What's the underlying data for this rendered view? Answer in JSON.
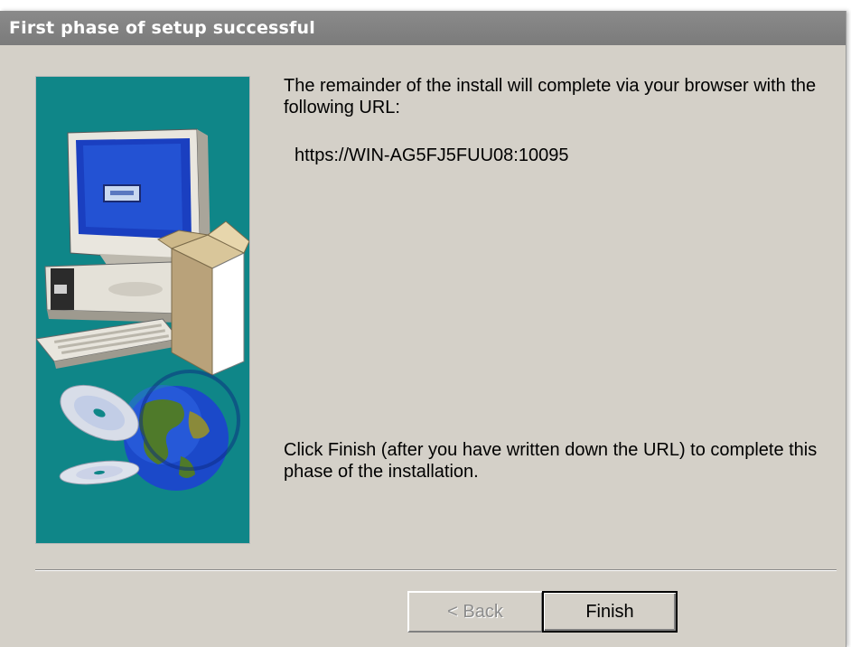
{
  "window": {
    "title": "First phase of setup successful"
  },
  "main": {
    "intro_text": "The remainder of the install will complete via your browser with the following URL:",
    "url": "https://WIN-AG5FJ5FUU08:10095",
    "instruction_text": "Click Finish (after you have written down the URL) to complete this phase of the installation."
  },
  "buttons": {
    "back_label": "< Back",
    "finish_label": "Finish"
  },
  "sidebar": {
    "image": "computer-box-cds-globe-illustration"
  }
}
